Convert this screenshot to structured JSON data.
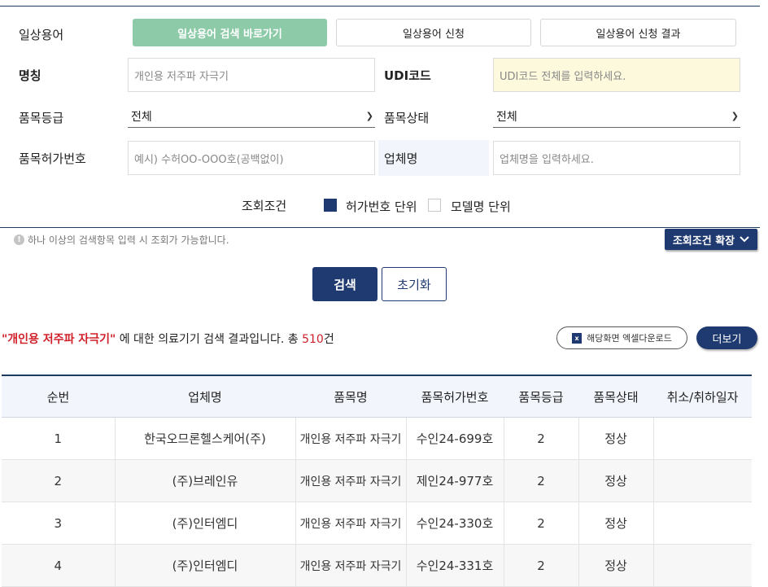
{
  "search_form": {
    "label_term": "일상용어",
    "tabs": [
      "일상용어 검색 바로가기",
      "일상용어 신청",
      "일상용어 신청 결과"
    ],
    "label_name": "명칭",
    "name_value": "개인용 저주파 자극기",
    "label_udi": "UDI코드",
    "udi_placeholder": "UDI코드 전체를 입력하세요.",
    "label_grade": "품목등급",
    "grade_value": "전체",
    "label_status": "품목상태",
    "status_value": "전체",
    "label_permit": "품목허가번호",
    "permit_placeholder": "예시) 수허OO-OOO호(공백없이)",
    "label_company": "업체명",
    "company_placeholder": "업체명을 입력하세요.",
    "label_condition": "조회조건",
    "option_permit_unit": "허가번호 단위",
    "option_model_unit": "모델명 단위",
    "notice": "하나 이상의 검색항목 입력 시 조회가 가능합니다.",
    "expand_label": "조회조건 확장",
    "search_button": "검색",
    "reset_button": "초기화"
  },
  "results": {
    "query": "\"개인용 저주파 자극기\"",
    "text_mid": " 에 대한 의료기기 검색 결과입니다. 총 ",
    "count": "510",
    "unit": "건",
    "excel_label": "해당화면 엑셀다운로드",
    "more_label": "더보기",
    "columns": [
      "순번",
      "업체명",
      "품목명",
      "품목허가번호",
      "품목등급",
      "품목상태",
      "취소/취하일자"
    ],
    "rows": [
      [
        "1",
        "한국오므론헬스케어(주)",
        "개인용 저주파 자극기",
        "수인24-699호",
        "2",
        "정상",
        ""
      ],
      [
        "2",
        "(주)브레인유",
        "개인용 저주파 자극기",
        "제인24-977호",
        "2",
        "정상",
        ""
      ],
      [
        "3",
        "(주)인터엠디",
        "개인용 저주파 자극기",
        "수인24-330호",
        "2",
        "정상",
        ""
      ],
      [
        "4",
        "(주)인터엠디",
        "개인용 저주파 자극기",
        "수인24-331호",
        "2",
        "정상",
        ""
      ]
    ]
  },
  "colors": {
    "navy": "#1f3a70",
    "green_tab": "#8ccaa8",
    "highlight_red": "#d0202a",
    "udi_yellow": "#fdf9dc"
  },
  "icons": [
    "info-icon",
    "chevron-down-icon",
    "excel-icon"
  ]
}
